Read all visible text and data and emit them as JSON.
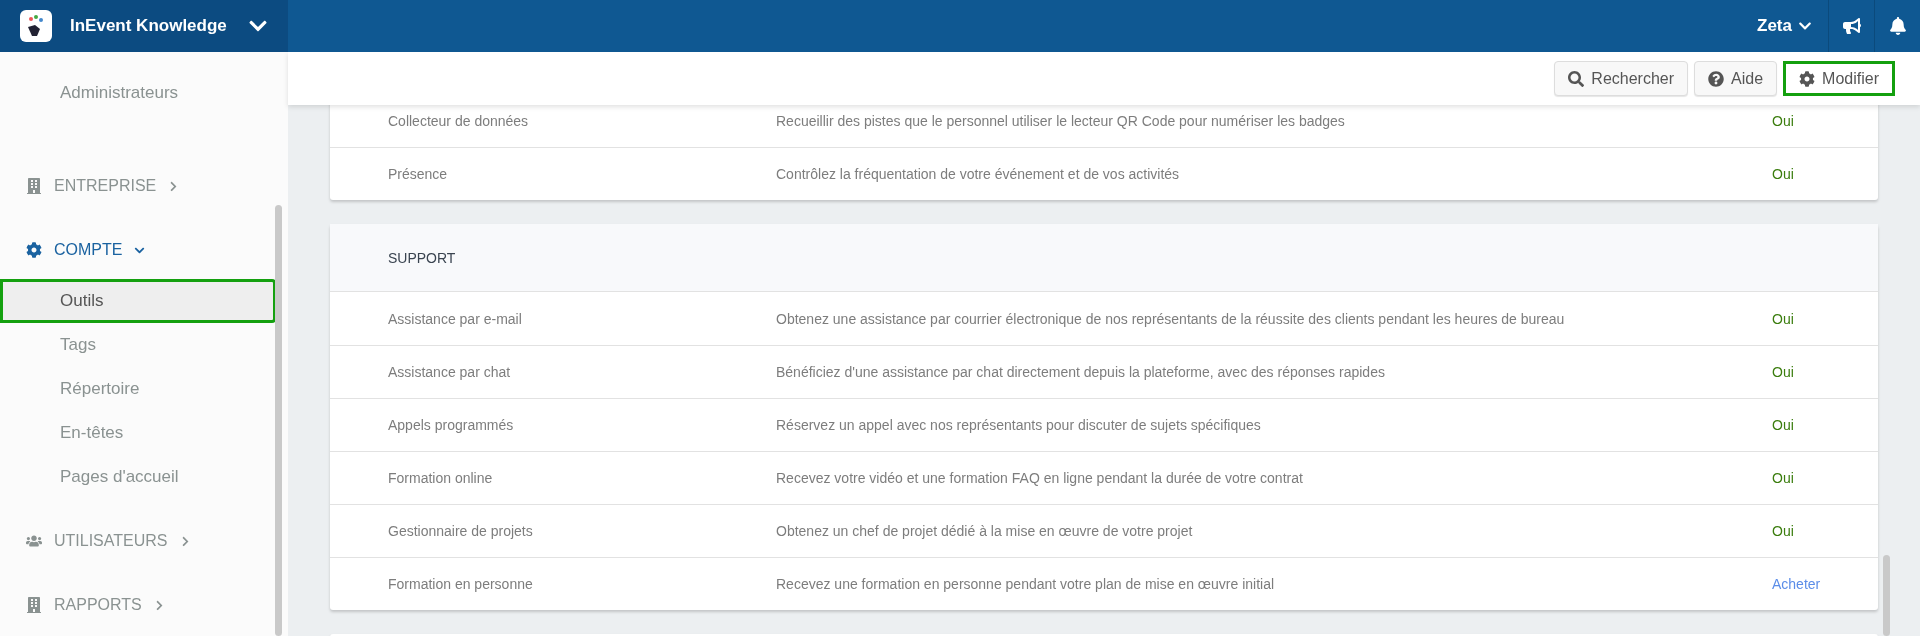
{
  "brand": {
    "name": "InEvent Knowledge"
  },
  "user": {
    "name": "Zeta"
  },
  "sidebar": {
    "items": [
      {
        "label": "Administrateurs",
        "selected": false,
        "highlighted": false
      }
    ],
    "sections": [
      {
        "label": "ENTREPRISE",
        "kind": "building",
        "expanded": false,
        "active": false
      },
      {
        "label": "COMPTE",
        "kind": "gear",
        "expanded": true,
        "active": true,
        "items": [
          {
            "label": "Outils",
            "selected": true,
            "highlighted": true
          },
          {
            "label": "Tags",
            "selected": false,
            "highlighted": false
          },
          {
            "label": "Répertoire",
            "selected": false,
            "highlighted": false
          },
          {
            "label": "En-têtes",
            "selected": false,
            "highlighted": false
          },
          {
            "label": "Pages d'accueil",
            "selected": false,
            "highlighted": false
          }
        ]
      },
      {
        "label": "UTILISATEURS",
        "kind": "users",
        "expanded": false,
        "active": false
      },
      {
        "label": "RAPPORTS",
        "kind": "building",
        "expanded": false,
        "active": false
      }
    ]
  },
  "toolbar": {
    "buttons": [
      {
        "label": "Rechercher",
        "kind": "search",
        "highlighted": false
      },
      {
        "label": "Aide",
        "kind": "help",
        "highlighted": false
      },
      {
        "label": "Modifier",
        "kind": "gear",
        "highlighted": true
      }
    ]
  },
  "cards": [
    {
      "rows": [
        {
          "name": "Collecteur de données",
          "description": "Recueillir des pistes que le personnel utiliser le lecteur QR Code pour numériser les badges",
          "status": "Oui",
          "kind": "included"
        },
        {
          "name": "Présence",
          "description": "Contrôlez la fréquentation de votre événement et de vos activités",
          "status": "Oui",
          "kind": "included"
        }
      ]
    },
    {
      "title": "SUPPORT",
      "rows": [
        {
          "name": "Assistance par e-mail",
          "description": "Obtenez une assistance par courrier électronique de nos représentants de la réussite des clients pendant les heures de bureau",
          "status": "Oui",
          "kind": "included"
        },
        {
          "name": "Assistance par chat",
          "description": "Bénéficiez d'une assistance par chat directement depuis la plateforme, avec des réponses rapides",
          "status": "Oui",
          "kind": "included"
        },
        {
          "name": "Appels programmés",
          "description": "Réservez un appel avec nos représentants pour discuter de sujets spécifiques",
          "status": "Oui",
          "kind": "included"
        },
        {
          "name": "Formation online",
          "description": "Recevez votre vidéo et une formation FAQ en ligne pendant la durée de votre contrat",
          "status": "Oui",
          "kind": "included"
        },
        {
          "name": "Gestionnaire de projets",
          "description": "Obtenez un chef de projet dédié à la mise en œuvre de votre projet",
          "status": "Oui",
          "kind": "included"
        },
        {
          "name": "Formation en personne",
          "description": "Recevez une formation en personne pendant votre plan de mise en œuvre initial",
          "status": "Acheter",
          "kind": "buy"
        }
      ]
    },
    {
      "cut_off": true
    }
  ]
}
